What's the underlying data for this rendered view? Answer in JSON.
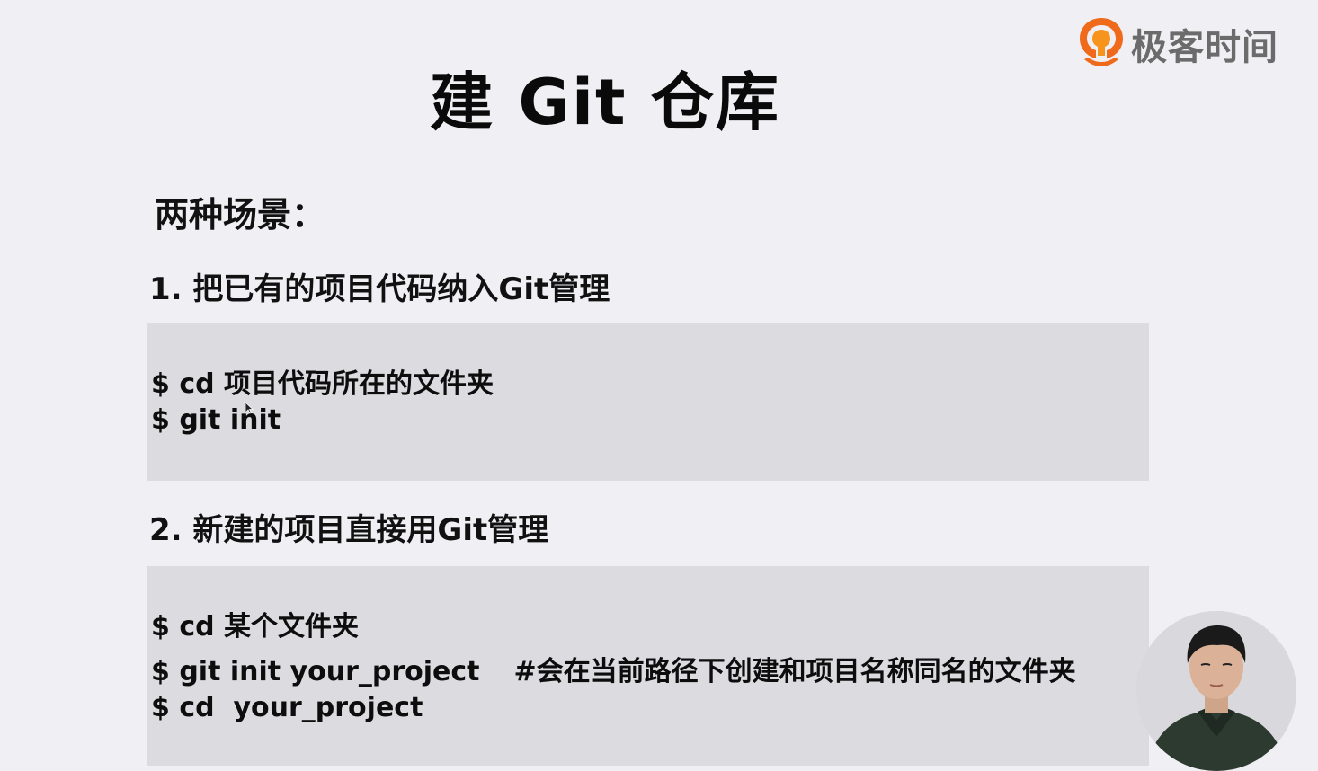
{
  "slide": {
    "title": "建 Git 仓库",
    "logo_text": "极客时间",
    "scenes_heading": "两种场景：",
    "section1": {
      "heading": "1. 把已有的项目代码纳入Git管理",
      "lines": [
        "$ cd 项目代码所在的文件夹",
        "$ git init"
      ]
    },
    "section2": {
      "heading": "2. 新建的项目直接用Git管理",
      "line1": "$ cd 某个文件夹",
      "line2_cmd": "$ git init your_project",
      "line2_comment": "#会在当前路径下创建和项目名称同名的文件夹",
      "line3": "$ cd  your_project"
    }
  },
  "colors": {
    "background": "#f0eff3",
    "code_box": "#dcdbdf",
    "logo_orange": "#f06a1c",
    "logo_text": "#6b6b6b"
  },
  "icons": {
    "logo": "geektime-logo-icon",
    "cursor": "mouse-pointer-icon",
    "presenter": "presenter-video-thumbnail"
  }
}
